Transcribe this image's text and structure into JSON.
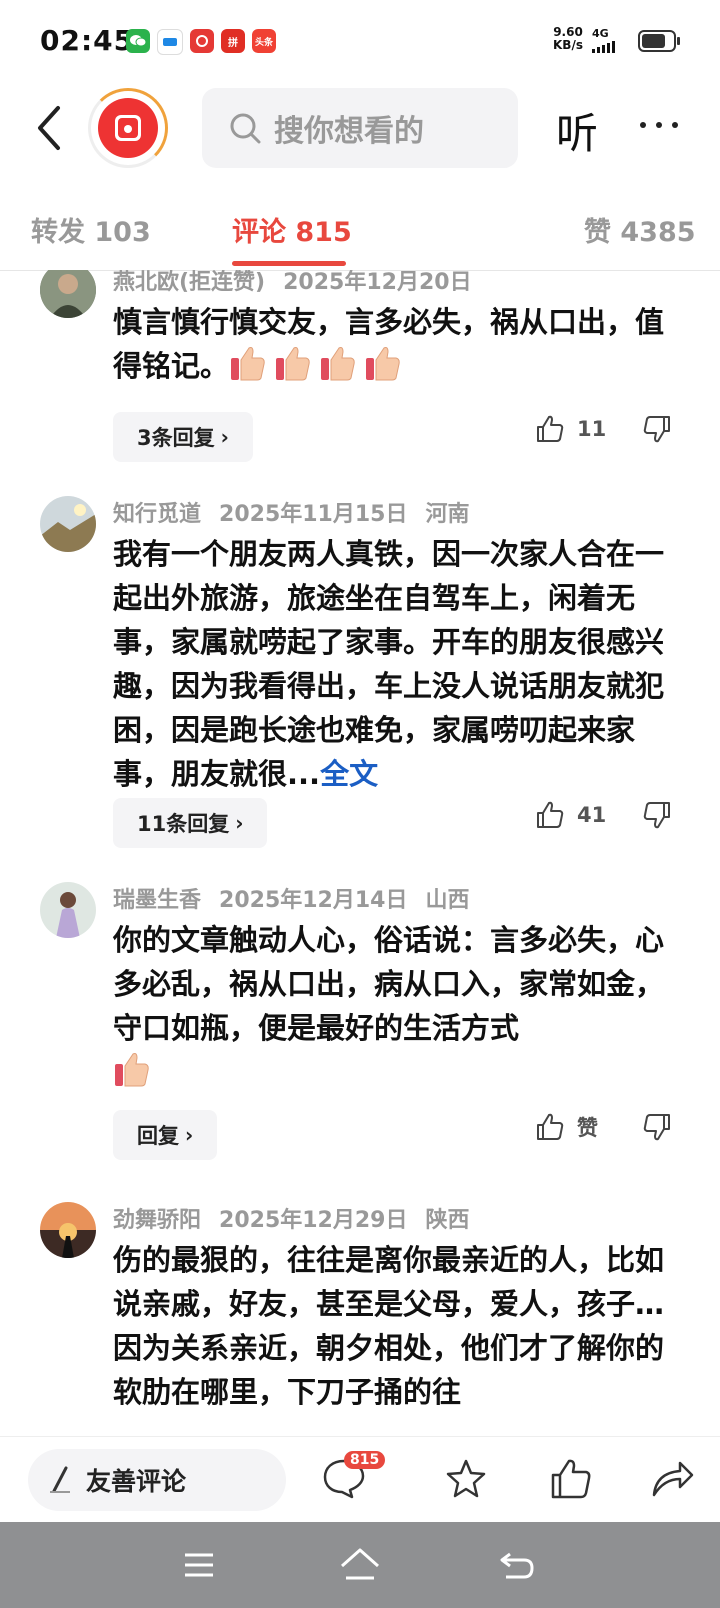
{
  "status_bar": {
    "time": "02:45",
    "net_speed_value": "9.60",
    "net_speed_unit": "KB/s",
    "network_type": "4G",
    "app_icons": [
      "wechat-icon",
      "alipay-icon",
      "toutiao-icon",
      "pinduoduo-icon",
      "toutiao-news-icon"
    ],
    "pinduoduo_label": "拼",
    "news_label": "头条"
  },
  "header": {
    "search_placeholder": "搜你想看的",
    "listen_label": "听"
  },
  "tabs": [
    {
      "label": "转发 103"
    },
    {
      "label": "评论 815"
    },
    {
      "label": "赞 4385"
    }
  ],
  "comments": [
    {
      "user": "燕北欧(拒连赞)",
      "date": "2025年12月20日",
      "location": "",
      "text": "慎言慎行慎交友，言多必失，祸从口出，值得铭记。",
      "reply_label": "3条回复",
      "likes": "11"
    },
    {
      "user": "知行觅道",
      "date": "2025年11月15日",
      "location": "河南",
      "text": "我有一个朋友两人真铁，因一次家人合在一起出外旅游，旅途坐在自驾车上，闲着无事，家属就唠起了家事。开车的朋友很感兴趣，因为我看得出，车上没人说话朋友就犯困，因是跑长途也难免，家属唠叨起来家事，朋友就很...",
      "full_text_link": "全文",
      "reply_label": "11条回复",
      "likes": "41"
    },
    {
      "user": "瑞墨生香",
      "date": "2025年12月14日",
      "location": "山西",
      "text": "你的文章触动人心，俗话说：言多必失，心多必乱，祸从口出，病从口入，家常如金，守口如瓶，便是最好的生活方式",
      "reply_label": "回复",
      "likes": "赞"
    },
    {
      "user": "劲舞骄阳",
      "date": "2025年12月29日",
      "location": "陕西",
      "text": "伤的最狠的，往往是离你最亲近的人，比如说亲戚，好友，甚至是父母，爱人，孩子…因为关系亲近，朝夕相处，他们才了解你的软肋在哪里，下刀子捅的往"
    }
  ],
  "bottom_bar": {
    "compose_label": "友善评论",
    "comment_badge": "815"
  },
  "colors": {
    "accent": "#e8483e",
    "link": "#1b5ec4"
  }
}
